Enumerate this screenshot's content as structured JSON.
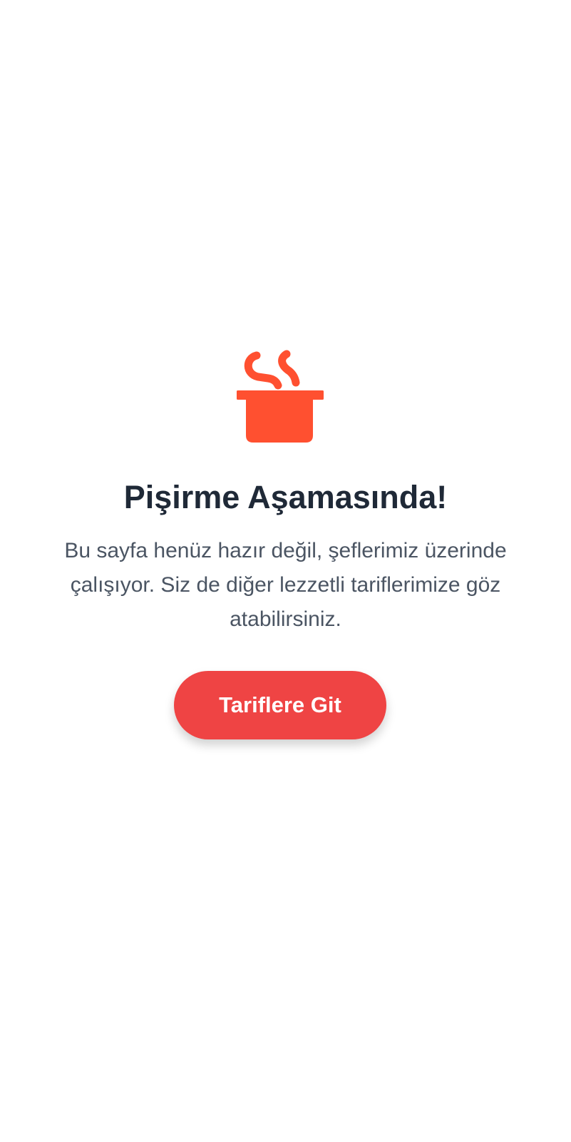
{
  "icon": {
    "name": "cooking-pot-icon",
    "color": "#ff5030"
  },
  "heading": {
    "title": "Pişirme Aşamasında!",
    "message": "Bu sayfa henüz hazır değil, şeflerimiz üzerinde çalışıyor. Siz de diğer lezzetli tariflerimize göz atabilirsiniz."
  },
  "cta": {
    "label": "Tariflere Git",
    "color": "#ef4444"
  },
  "colors": {
    "background": "#ffffff",
    "title": "#1f2937",
    "text": "#4b5563"
  }
}
